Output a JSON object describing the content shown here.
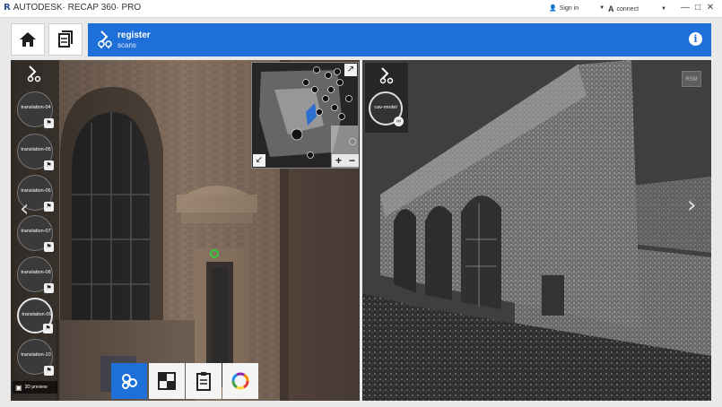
{
  "window": {
    "app_title": "AUTODESK· RECAP 360· PRO",
    "signin_label": "Sign in",
    "connect_label": "connect"
  },
  "header": {
    "title": "register",
    "subtitle": "scans"
  },
  "left_panel": {
    "scans": [
      {
        "label": "translation-04"
      },
      {
        "label": "translation-05"
      },
      {
        "label": "translation-06"
      },
      {
        "label": "translation-07"
      },
      {
        "label": "translation-08"
      },
      {
        "label": "translation-09",
        "selected": true
      },
      {
        "label": "translation-10"
      }
    ],
    "footer_label": "3D preview"
  },
  "right_panel": {
    "scan_label": "cav-model",
    "sm_label": "RSM"
  },
  "colors": {
    "accent": "#1f6fd8",
    "background": "#e9e9e9"
  }
}
